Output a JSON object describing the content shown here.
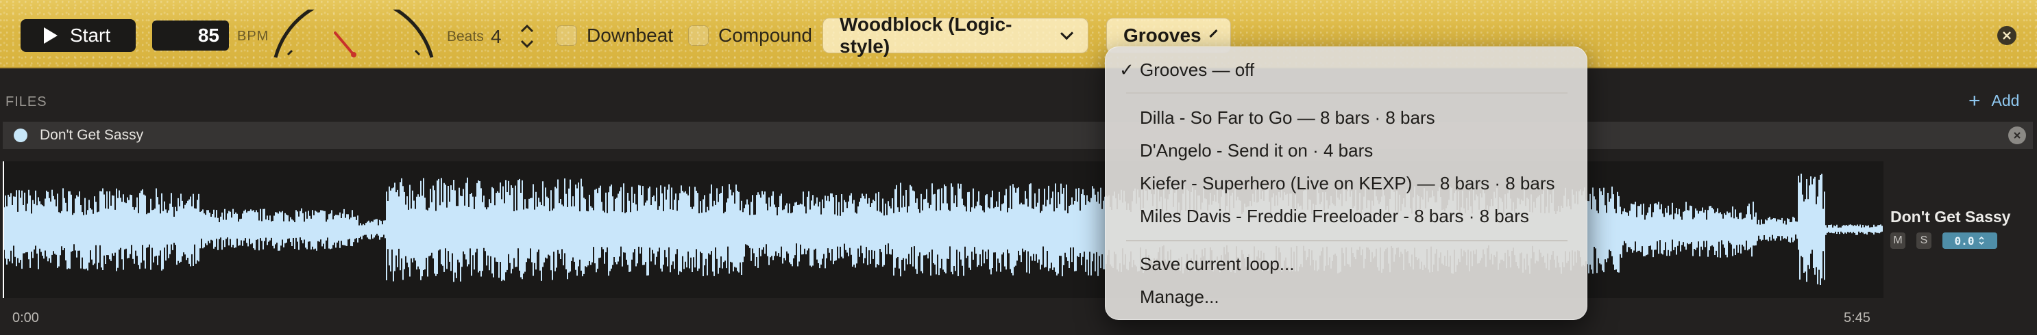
{
  "toolbar": {
    "start_label": "Start",
    "bpm_value": "85",
    "bpm_unit": "BPM",
    "beats_label": "Beats",
    "beats_value": "4",
    "downbeat_label": "Downbeat",
    "compound_label": "Compound",
    "sound_dropdown_label": "Woodblock (Logic-style)",
    "grooves_dropdown_label": "Grooves"
  },
  "files": {
    "section_label": "FILES",
    "add_label": "Add",
    "items": [
      {
        "name": "Don't Get Sassy"
      }
    ]
  },
  "track": {
    "title": "Don't Get Sassy",
    "mute_label": "M",
    "solo_label": "S",
    "gain_value": "0.0",
    "time_start": "0:00",
    "time_end": "5:45",
    "waveform_color": "#c9e6fa"
  },
  "grooves_menu": {
    "checked_item": "Grooves — off",
    "grooves": [
      "Dilla - So Far to Go — 8 bars · 8 bars",
      "D'Angelo - Send it on · 4 bars",
      "Kiefer - Superhero (Live on KEXP) — 8 bars · 8 bars",
      "Miles Davis - Freddie Freeloader - 8 bars · 8 bars"
    ],
    "save_label": "Save current loop...",
    "manage_label": "Manage..."
  },
  "colors": {
    "toolbar_gold": "#dcb845",
    "background": "#232120",
    "accent_blue": "#8fc8f0"
  }
}
